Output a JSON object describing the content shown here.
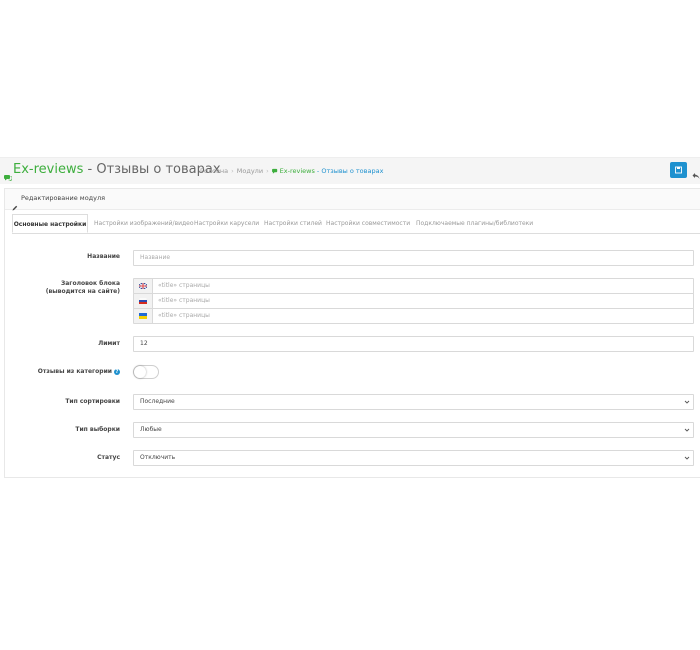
{
  "header": {
    "title_main": "Ex-reviews",
    "title_rest": " - Отзывы о товарах",
    "breadcrumb": {
      "home": "Головна",
      "modules": "Модули",
      "current_main": "Ex-reviews",
      "current_rest": " - Отзывы о товарах"
    }
  },
  "panel": {
    "title": "Редактирование модуля",
    "tabs": [
      {
        "label": "Основные настройки",
        "active": true
      },
      {
        "label": "Настройки изображений/видео",
        "active": false
      },
      {
        "label": "Настройки карусели",
        "active": false
      },
      {
        "label": "Настройки стилей",
        "active": false
      },
      {
        "label": "Настройки совместимости",
        "active": false
      },
      {
        "label": "Подключаемые плагины/библиотеки",
        "active": false
      }
    ]
  },
  "form": {
    "name": {
      "label": "Название",
      "placeholder": "Название",
      "value": ""
    },
    "block_title": {
      "label": "Заголовок блока (выводится на сайте)",
      "langs": [
        {
          "flag": "uk-flag-icon",
          "placeholder": "«title» страницы"
        },
        {
          "flag": "ru-flag-icon",
          "placeholder": "«title» страницы"
        },
        {
          "flag": "ua-flag-icon",
          "placeholder": "«title» страницы"
        }
      ]
    },
    "limit": {
      "label": "Лимит",
      "value": "12"
    },
    "from_category": {
      "label": "Отзывы из категории",
      "help": "?",
      "enabled": false
    },
    "sort_type": {
      "label": "Тип сортировки",
      "value": "Последние"
    },
    "selection_type": {
      "label": "Тип выборки",
      "value": "Любые"
    },
    "status": {
      "label": "Статус",
      "value": "Отключить"
    }
  },
  "colors": {
    "accent_green": "#3dae3d",
    "accent_blue": "#1e91cf"
  }
}
